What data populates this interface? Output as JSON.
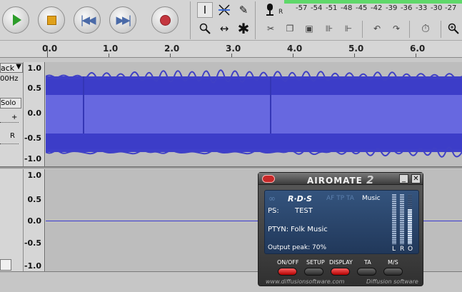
{
  "toolbar": {
    "play": "play-icon",
    "stop": "stop-icon",
    "skip_start": "skip-start-icon",
    "skip_end": "skip-end-icon",
    "record": "record-icon",
    "meter_r_label": "R",
    "meter_scale": [
      "-57",
      "-54",
      "-51",
      "-48",
      "-45",
      "-42",
      "-39",
      "-36",
      "-33",
      "-30",
      "-27"
    ]
  },
  "ruler": {
    "ticks": [
      "0.0",
      "1.0",
      "2.0",
      "3.0",
      "4.0",
      "5.0",
      "6.0"
    ]
  },
  "track1": {
    "menu_label": "ack",
    "rate": "00Hz",
    "solo": "Solo",
    "pan_right": "R",
    "scale": [
      "1.0",
      "0.5",
      "0.0",
      "-0.5",
      "-1.0"
    ]
  },
  "track2": {
    "scale": [
      "1.0",
      "0.5",
      "0.0",
      "-0.5",
      "-1.0"
    ]
  },
  "airomate": {
    "title": "AIROMATE",
    "version": "2",
    "rds_logo": "R·D·S",
    "flags": "AF TP TA",
    "music": "Music",
    "ps_label": "PS:",
    "ps_value": "TEST",
    "ptyn_label": "PTYN:",
    "ptyn_value": "Folk Music",
    "output_peak": "Output peak: 70%",
    "meter_labels": [
      "L",
      "R",
      "O"
    ],
    "buttons": [
      "ON/OFF",
      "SETUP",
      "DISPLAY",
      "TA",
      "M/S"
    ],
    "footer_left": "www.diffusionsoftware.com",
    "footer_right": "Diffusion software",
    "colors": {
      "panel": "#2b4468",
      "active_button": "#d92020"
    }
  }
}
